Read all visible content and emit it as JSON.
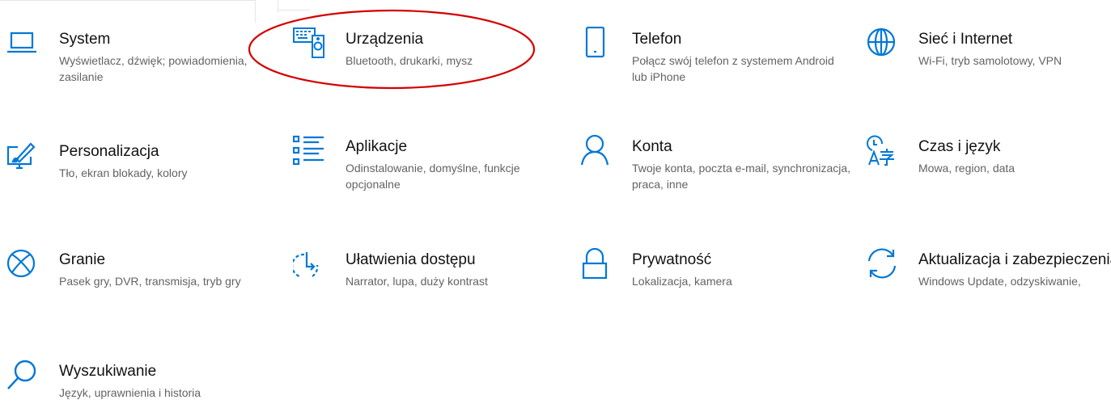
{
  "accent_color": "#0078d7",
  "highlight_color": "#d40000",
  "tiles": [
    {
      "title": "System",
      "desc": "Wyświetlacz, dźwięk; powiadomienia, zasilanie",
      "icon": "laptop-icon"
    },
    {
      "title": "Urządzenia",
      "desc": "Bluetooth, drukarki, mysz",
      "icon": "devices-icon"
    },
    {
      "title": "Telefon",
      "desc": "Połącz swój telefon z systemem Android lub iPhone",
      "icon": "phone-icon"
    },
    {
      "title": "Sieć i Internet",
      "desc": "Wi-Fi, tryb samolotowy, VPN",
      "icon": "globe-icon"
    },
    {
      "title": "Personalizacja",
      "desc": "Tło, ekran blokady, kolory",
      "icon": "personalization-icon"
    },
    {
      "title": "Aplikacje",
      "desc": "Odinstalowanie, domyślne, funkcje opcjonalne",
      "icon": "apps-list-icon"
    },
    {
      "title": "Konta",
      "desc": "Twoje konta, poczta e-mail, synchronizacja, praca, inne",
      "icon": "person-icon"
    },
    {
      "title": "Czas i język",
      "desc": "Mowa, region, data",
      "icon": "time-language-icon"
    },
    {
      "title": "Granie",
      "desc": "Pasek gry, DVR, transmisja, tryb gry",
      "icon": "xbox-icon"
    },
    {
      "title": "Ułatwienia dostępu",
      "desc": "Narrator, lupa, duży kontrast",
      "icon": "ease-of-access-icon"
    },
    {
      "title": "Prywatność",
      "desc": "Lokalizacja, kamera",
      "icon": "lock-icon"
    },
    {
      "title": "Aktualizacja i zabezpieczenia",
      "desc": "Windows Update, odzyskiwanie,",
      "icon": "update-icon"
    },
    {
      "title": "Wyszukiwanie",
      "desc": "Język, uprawnienia i historia",
      "icon": "search-icon"
    }
  ]
}
